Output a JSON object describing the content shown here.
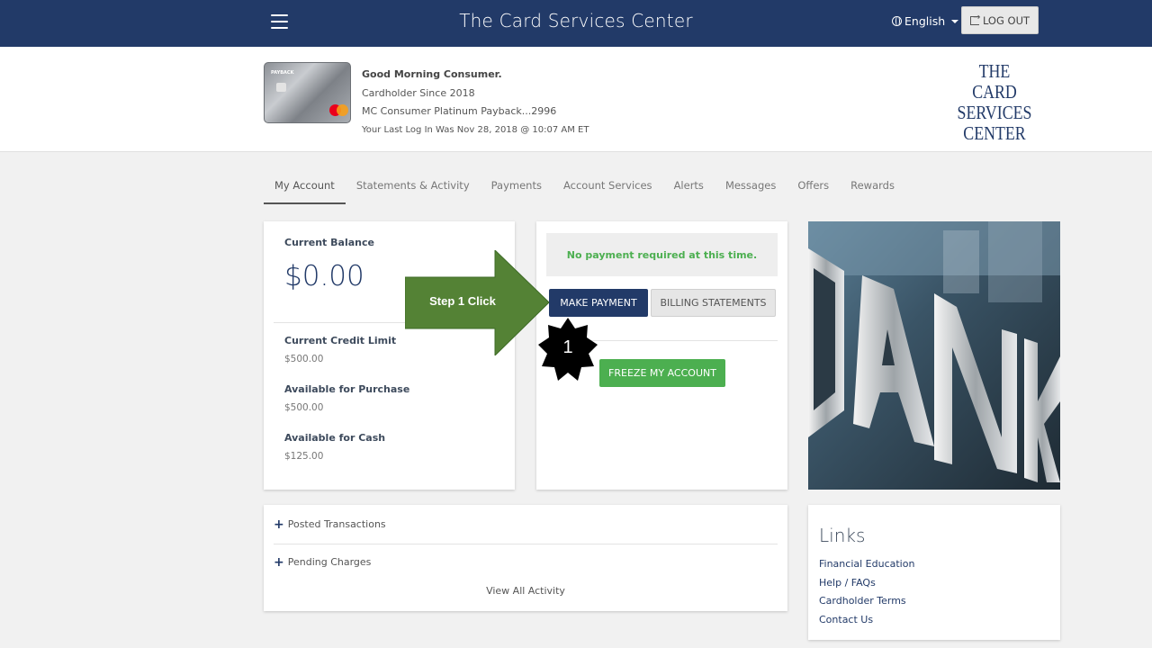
{
  "header": {
    "title": "The Card Services Center",
    "language": "English",
    "logout_label": "LOG OUT"
  },
  "profile": {
    "greeting": "Good Morning Consumer.",
    "since": "Cardholder Since 2018",
    "product": "MC Consumer Platinum Payback...2996",
    "last_login": "Your Last Log In Was Nov 28, 2018 @ 10:07 AM ET",
    "card_brand_text": "PAYBACK",
    "logo_lines": [
      "THE",
      "CARD SERVICES",
      "CENTER"
    ]
  },
  "tabs": [
    {
      "label": "My Account",
      "active": true
    },
    {
      "label": "Statements & Activity"
    },
    {
      "label": "Payments"
    },
    {
      "label": "Account Services"
    },
    {
      "label": "Alerts"
    },
    {
      "label": "Messages"
    },
    {
      "label": "Offers"
    },
    {
      "label": "Rewards"
    }
  ],
  "balance": {
    "current_label": "Current Balance",
    "current_value": "$0.00",
    "credit_limit_label": "Current Credit Limit",
    "credit_limit_value": "$500.00",
    "purchase_label": "Available for Purchase",
    "purchase_value": "$500.00",
    "cash_label": "Available for Cash",
    "cash_value": "$125.00"
  },
  "actions": {
    "notice": "No payment required at this time.",
    "make_payment": "MAKE PAYMENT",
    "billing_statements": "BILLING STATEMENTS",
    "freeze": "FREEZE MY ACCOUNT"
  },
  "activity": {
    "posted": "Posted Transactions",
    "pending": "Pending Charges",
    "view_all": "View All Activity"
  },
  "links": {
    "title": "Links",
    "items": [
      "Financial Education",
      "Help / FAQs",
      "Cardholder Terms",
      "Contact Us"
    ]
  },
  "annotation": {
    "step_text": "Step 1 Click",
    "step_number": "1"
  },
  "colors": {
    "navy": "#223a68",
    "green": "#4caf50",
    "arrow_green": "#548235"
  }
}
